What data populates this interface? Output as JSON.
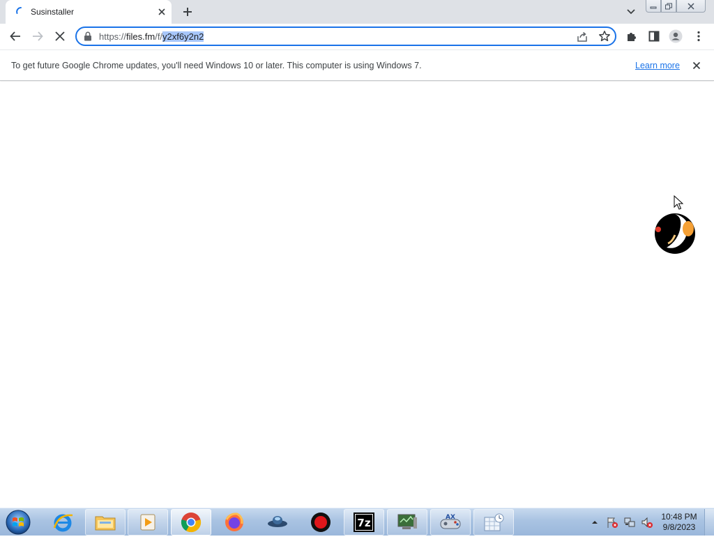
{
  "browser": {
    "tab": {
      "title": "Susinstaller"
    },
    "address": {
      "scheme": "https://",
      "host": "files.fm",
      "path_prefix": "/f/",
      "path_selected": "y2xf6y2n2"
    }
  },
  "infobar": {
    "message": "To get future Google Chrome updates, you'll need Windows 10 or later. This computer is using Windows 7.",
    "link": "Learn more"
  },
  "taskbar": {
    "apps": [
      {
        "name": "internet-explorer-icon"
      },
      {
        "name": "file-explorer-icon"
      },
      {
        "name": "media-player-icon"
      },
      {
        "name": "chrome-icon",
        "active": true
      },
      {
        "name": "firefox-icon"
      },
      {
        "name": "ufo-app-icon"
      },
      {
        "name": "record-icon"
      },
      {
        "name": "7zip-icon"
      },
      {
        "name": "monitor-app-icon"
      },
      {
        "name": "gamepad-app-icon"
      },
      {
        "name": "calendar-clock-icon"
      }
    ],
    "clock": {
      "time": "10:48 PM",
      "date": "9/8/2023"
    }
  },
  "colors": {
    "accent": "#1a73e8",
    "tabstrip": "#dee1e6",
    "selection": "#a8c7fa"
  }
}
